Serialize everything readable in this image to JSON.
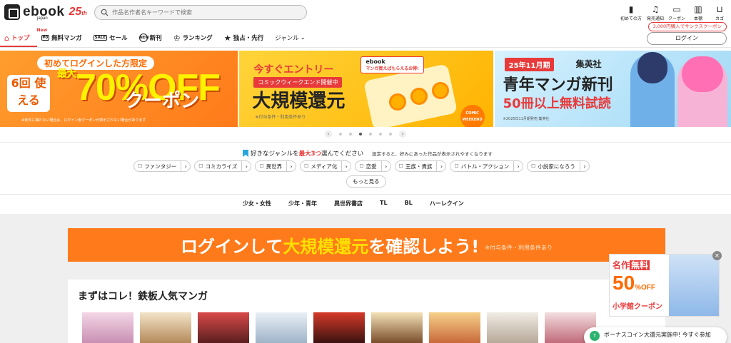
{
  "header": {
    "logo_text": "ebook",
    "logo_sub": "japan",
    "anniversary": "25",
    "anniversary_suffix": "th",
    "search_placeholder": "作品名作者名キーワードで検索",
    "top_nav": [
      {
        "icon": "book-icon",
        "glyph": "▮",
        "label": "初めての方"
      },
      {
        "icon": "bell-icon",
        "glyph": "♫",
        "label": "発売通知"
      },
      {
        "icon": "coupon-icon",
        "glyph": "▭",
        "label": "クーポン"
      },
      {
        "icon": "bookshelf-icon",
        "glyph": "▥",
        "label": "本棚"
      },
      {
        "icon": "cart-icon",
        "glyph": "⊔",
        "label": "カゴ"
      }
    ],
    "promo_pill": "3,000円購入でサンクスクーポン",
    "login_label": "ログイン"
  },
  "category_nav": {
    "items": [
      {
        "label": "トップ",
        "active": true
      },
      {
        "label": "無料マンガ",
        "badge": "New",
        "icon_text": "¥0"
      },
      {
        "label": "セール",
        "icon_text": "SALE"
      },
      {
        "label": "新刊",
        "icon_text": "NEW"
      },
      {
        "label": "ランキング"
      },
      {
        "label": "独占・先行"
      },
      {
        "label": "ジャンル"
      }
    ]
  },
  "banners": {
    "b1": {
      "top": "初めてログインした方限定",
      "left": "6回 使える",
      "max": "最大",
      "pct": "70%OFF",
      "coupon": "クーポン",
      "note": "※条件に満たない場合は、ログイン後クーポンが表示されない場合があります"
    },
    "b2": {
      "logo": "ebook",
      "t1": "今すぐエントリー",
      "t2": "コミックウィークエンド開催中",
      "t3": "大規模還元",
      "t4": "※付与条件・利用条件あり",
      "bubble": "マンガ買えばもらえるお得!",
      "badge": "COMIC WEEKEND"
    },
    "b3": {
      "tag": "25年11月期",
      "pub": "集英社",
      "t1": "青年マンガ新刊",
      "t2": "50冊以上無料試読",
      "t3": "※2025年11月期発売 集英社"
    }
  },
  "carousel": {
    "prev": "‹",
    "next": "›",
    "count": 6,
    "active": 2
  },
  "genre_select": {
    "heading_pre": "好きなジャンルを",
    "heading_em": "最大3つ",
    "heading_post": "選んでください",
    "sub": "設定すると、好みにあった作品が表示されやすくなります",
    "chips": [
      "ファンタジー",
      "コミカライズ",
      "異世界",
      "メディア化",
      "恋愛",
      "王族・貴族",
      "バトル・アクション",
      "小説家になろう"
    ],
    "more": "もっと見る"
  },
  "sub_nav": [
    "少女・女性",
    "少年・青年",
    "異世界書店",
    "TL",
    "BL",
    "ハーレクイン"
  ],
  "login_banner": {
    "pre": "ログインして",
    "em": "大規模還元",
    "post": "を確認しよう!",
    "note": "※付与条件・利用条件あり"
  },
  "section": {
    "title": "まずはコレ！鉄板人気マンガ"
  },
  "float_promo": {
    "t1": "名作",
    "t1b": "無料",
    "t2": "50",
    "t2s": "%OFF",
    "t3": "小学館クーポン",
    "close": "✕"
  },
  "toast": {
    "text": "ボーナスコイン大還元実施中! 今すぐ参加"
  },
  "colors": {
    "accent": "#e83a3a",
    "orange": "#ff7a1a"
  }
}
